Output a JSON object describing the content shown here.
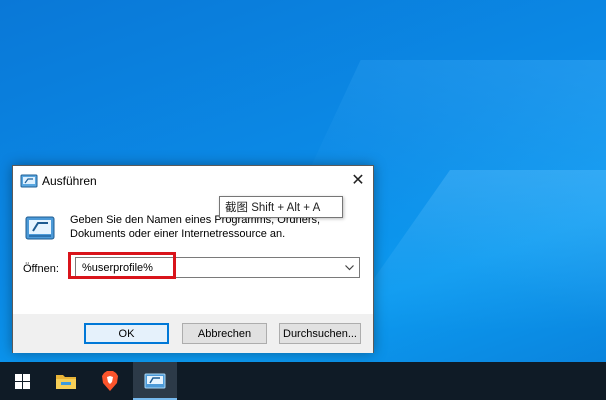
{
  "dialog": {
    "title": "Ausführen",
    "close_glyph": "✕",
    "description": "Geben Sie den Namen eines Programms, Ordners, Dokuments oder einer Internetressource an.",
    "open_label": "Öffnen:",
    "open_value": "%userprofile%",
    "buttons": {
      "ok": "OK",
      "cancel": "Abbrechen",
      "browse": "Durchsuchen..."
    }
  },
  "tooltip": {
    "text": "截图 Shift + Alt + A"
  },
  "taskbar": {
    "items": [
      {
        "icon": "windows-start-icon"
      },
      {
        "icon": "file-explorer-icon"
      },
      {
        "icon": "brave-browser-icon"
      },
      {
        "icon": "run-dialog-icon",
        "active": true
      }
    ]
  },
  "colors": {
    "highlight": "#d9141b",
    "accent": "#0078d7",
    "taskbar": "#0f1b26",
    "desktop": "#0b8ae6"
  }
}
